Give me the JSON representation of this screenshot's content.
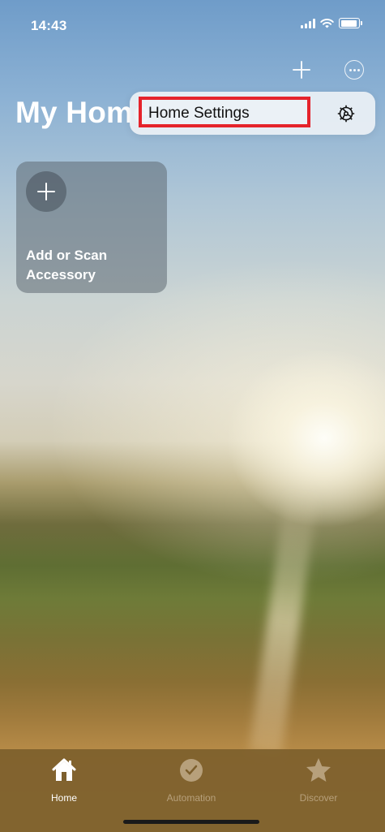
{
  "status_bar": {
    "time": "14:43",
    "icons": [
      "cellular-signal-icon",
      "wifi-icon",
      "battery-icon"
    ]
  },
  "header": {
    "title": "My Home",
    "add_icon": "plus-icon",
    "more_icon": "ellipsis-circle-icon"
  },
  "popup_menu": {
    "items": [
      {
        "label": "Home Settings",
        "icon": "gear-icon",
        "highlighted": true
      }
    ]
  },
  "tiles": [
    {
      "label": "Add or Scan Accessory",
      "icon": "plus-icon"
    }
  ],
  "tab_bar": {
    "tabs": [
      {
        "label": "Home",
        "icon": "house-icon",
        "active": true
      },
      {
        "label": "Automation",
        "icon": "clock-check-icon",
        "active": false
      },
      {
        "label": "Discover",
        "icon": "star-icon",
        "active": false
      }
    ]
  },
  "colors": {
    "highlight_border": "#e5232b",
    "tab_bar_bg": "#7d5f2d"
  }
}
